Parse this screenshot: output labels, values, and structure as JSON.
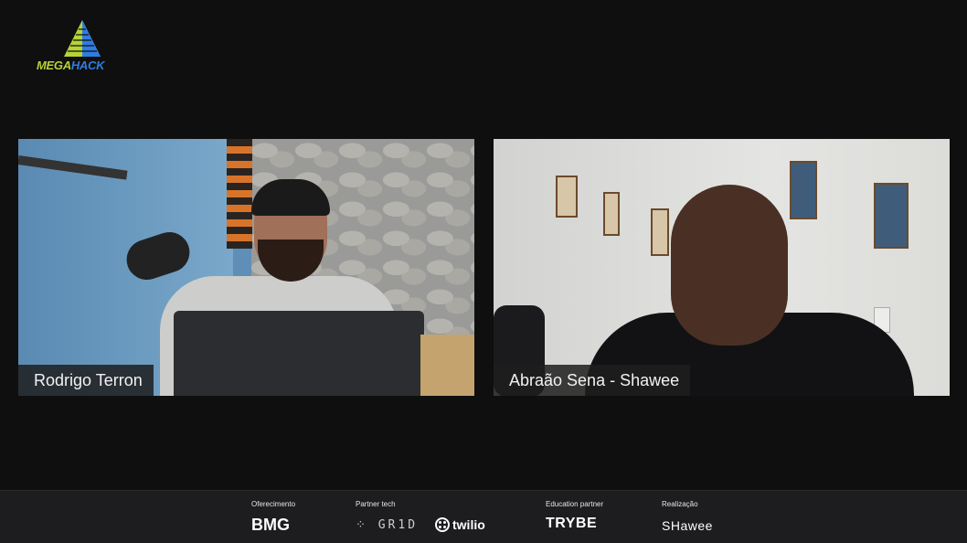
{
  "logo": {
    "mega": "MEGA",
    "hack": "HACK"
  },
  "participants": [
    {
      "name": "Rodrigo Terron"
    },
    {
      "name": "Abraão Sena - Shawee"
    }
  ],
  "sponsors": {
    "oferecimento": {
      "label": "Oferecimento",
      "logo": "BMG"
    },
    "partner_tech": {
      "label": "Partner tech",
      "grid_logo": "GR1D",
      "twilio_logo": "twilio"
    },
    "education_partner": {
      "label": "Education partner",
      "logo": "TRYBE"
    },
    "realizacao": {
      "label": "Realização",
      "logo": "SHawee"
    }
  },
  "colors": {
    "mega": "#b5d334",
    "hack": "#2f7de1",
    "background": "#0f0f10"
  }
}
